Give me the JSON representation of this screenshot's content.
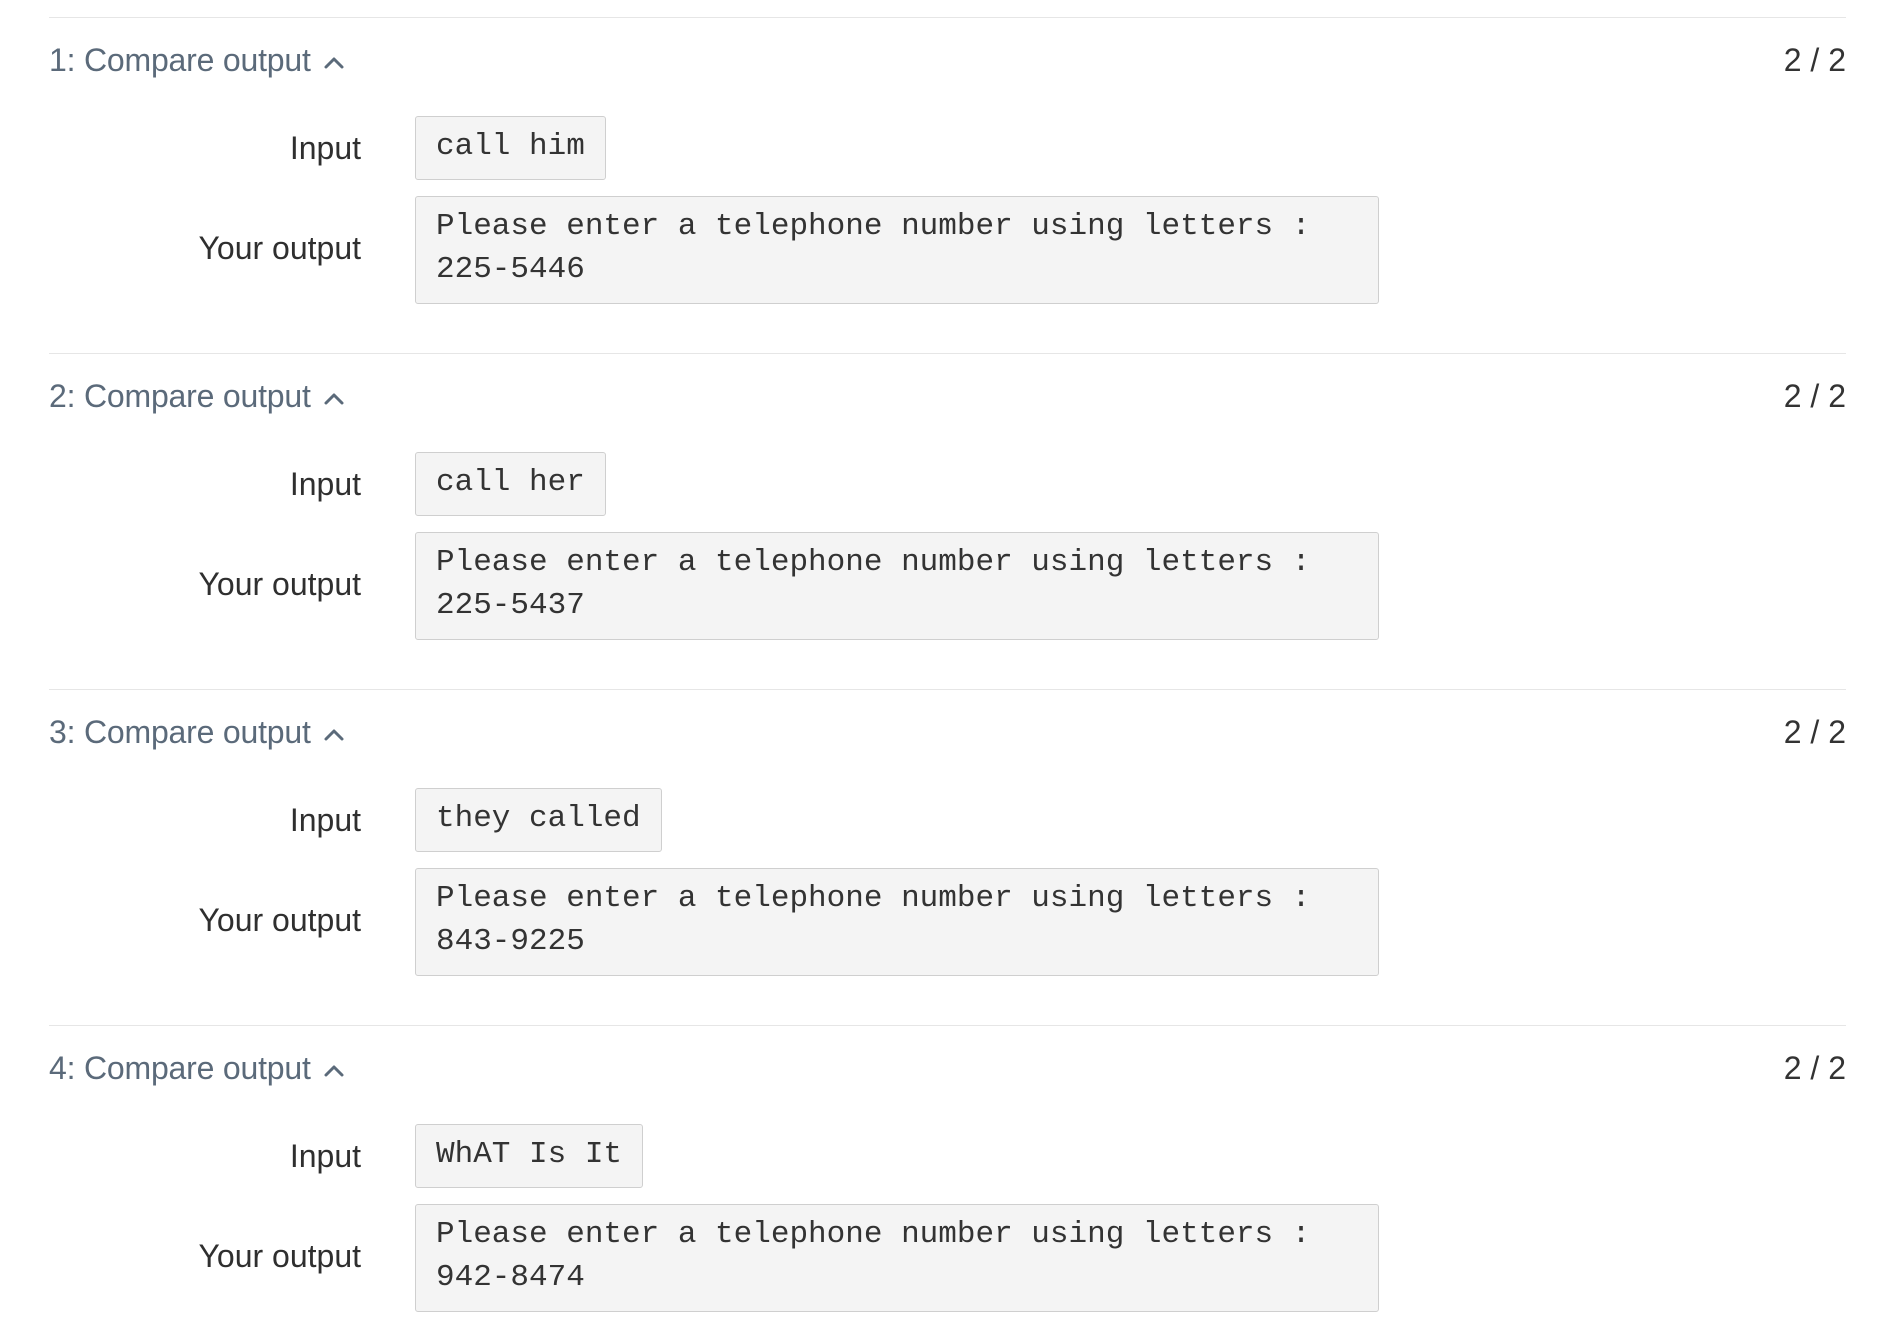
{
  "tests": [
    {
      "title": "1: Compare output",
      "score": "2 / 2",
      "input_label": "Input",
      "input": "call him",
      "output_label": "Your output",
      "output_lines": [
        "Please enter a telephone number using letters :",
        "225-5446"
      ]
    },
    {
      "title": "2: Compare output",
      "score": "2 / 2",
      "input_label": "Input",
      "input": "call her",
      "output_label": "Your output",
      "output_lines": [
        "Please enter a telephone number using letters :",
        "225-5437"
      ]
    },
    {
      "title": "3: Compare output",
      "score": "2 / 2",
      "input_label": "Input",
      "input": "they called",
      "output_label": "Your output",
      "output_lines": [
        "Please enter a telephone number using letters :",
        "843-9225"
      ]
    },
    {
      "title": "4: Compare output",
      "score": "2 / 2",
      "input_label": "Input",
      "input": "WhAT Is It",
      "output_label": "Your output",
      "output_lines": [
        "Please enter a telephone number using letters :",
        "942-8474"
      ]
    }
  ],
  "icons": {
    "toggle": "chevron-up-icon"
  },
  "colors": {
    "title": "#5b6a7a",
    "code_bg": "#f4f4f4",
    "code_border": "#cfcfcf",
    "divider": "#e6e6e6"
  }
}
